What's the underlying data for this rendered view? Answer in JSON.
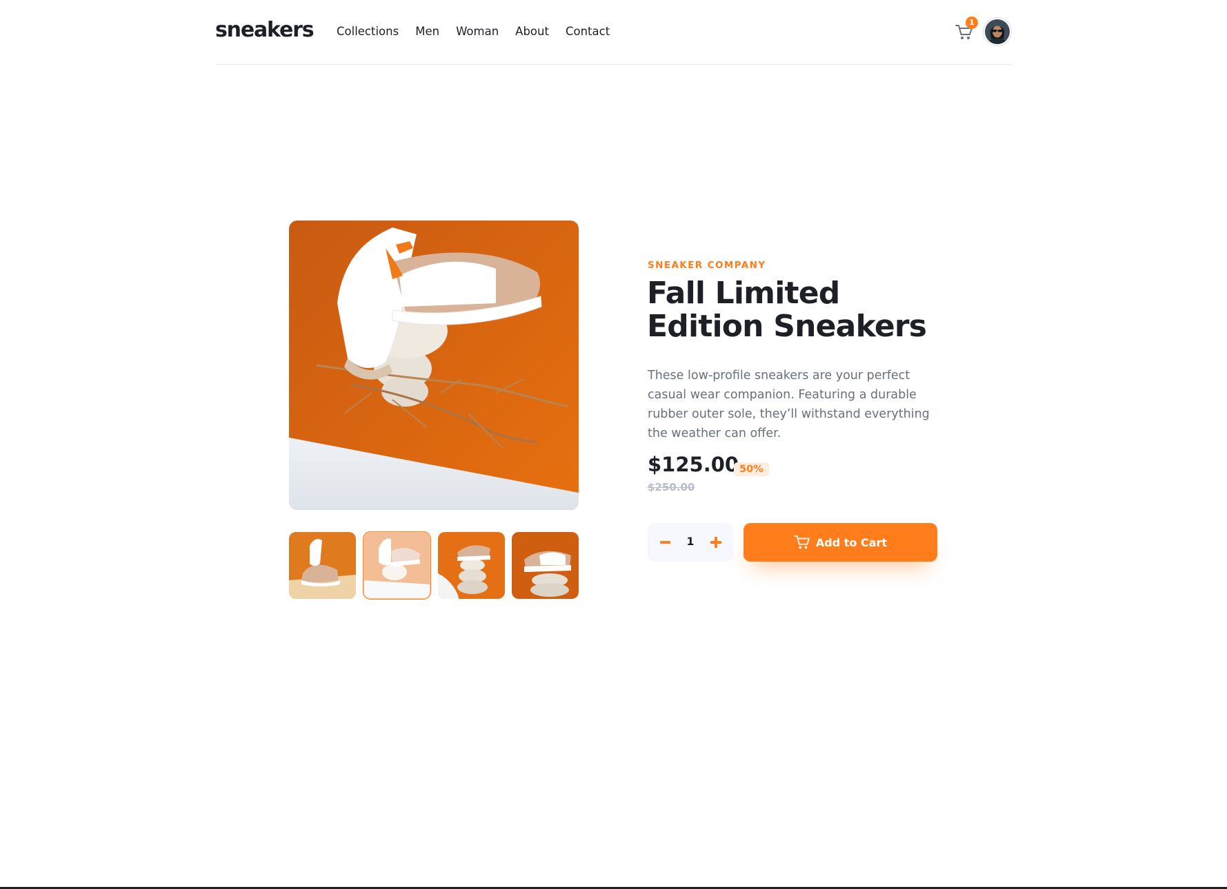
{
  "header": {
    "logo": "sneakers",
    "nav": [
      "Collections",
      "Men",
      "Woman",
      "About",
      "Contact"
    ],
    "cart_count": "1"
  },
  "product": {
    "company": "SNEAKER COMPANY",
    "title": "Fall Limited Edition Sneakers",
    "description": "These low-profile sneakers are your perfect casual wear companion. Featuring a durable rubber outer sole, they’ll withstand everything the weather can offer.",
    "price": "$125.00",
    "discount": "50%",
    "original_price": "$250.00",
    "quantity": "1",
    "add_to_cart_label": "Add to Cart",
    "active_thumbnail": 2
  },
  "colors": {
    "accent": "#ff7e1b",
    "accent_pale": "#ffede0",
    "text_dark": "#1d2026",
    "text_gray": "#68707d",
    "light_bg": "#f6f8fd"
  }
}
